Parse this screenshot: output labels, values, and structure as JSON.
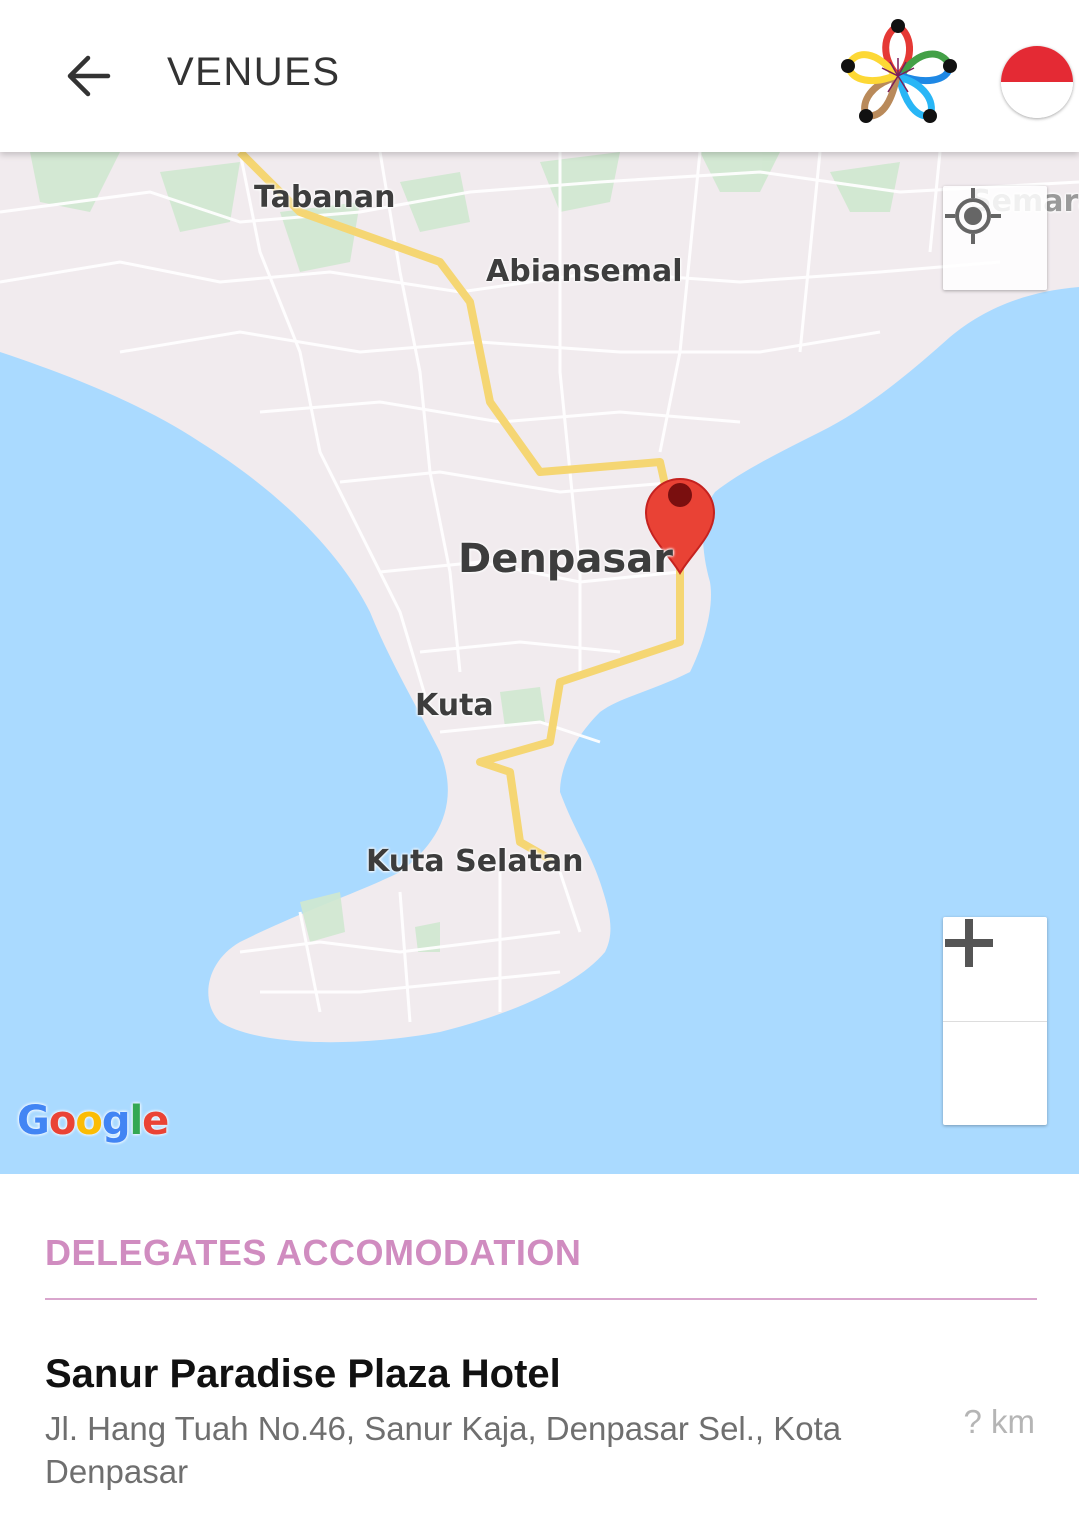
{
  "header": {
    "title": "VENUES",
    "back_icon": "arrow-left-icon",
    "logo": "event-flower-logo",
    "language_flag": "indonesia-flag"
  },
  "map": {
    "labels": {
      "tabanan": "Tabanan",
      "abiansemal": "Abiansemal",
      "semarapura": "Semara",
      "denpasar": "Denpasar",
      "kuta": "Kuta",
      "kuta_selatan": "Kuta Selatan"
    },
    "attribution": "Google",
    "controls": {
      "locate_icon": "my-location-icon",
      "zoom_in": "+",
      "zoom_out": "−"
    },
    "colors": {
      "water": "#aadaff",
      "land": "#f1ebee",
      "road": "#f5d673",
      "marker": "#e94235"
    }
  },
  "section": {
    "title": "DELEGATES ACCOMODATION"
  },
  "venues": [
    {
      "name": "Sanur Paradise Plaza Hotel",
      "address": "Jl. Hang Tuah No.46, Sanur Kaja, Denpasar Sel., Kota Denpasar",
      "distance": "? km"
    }
  ]
}
